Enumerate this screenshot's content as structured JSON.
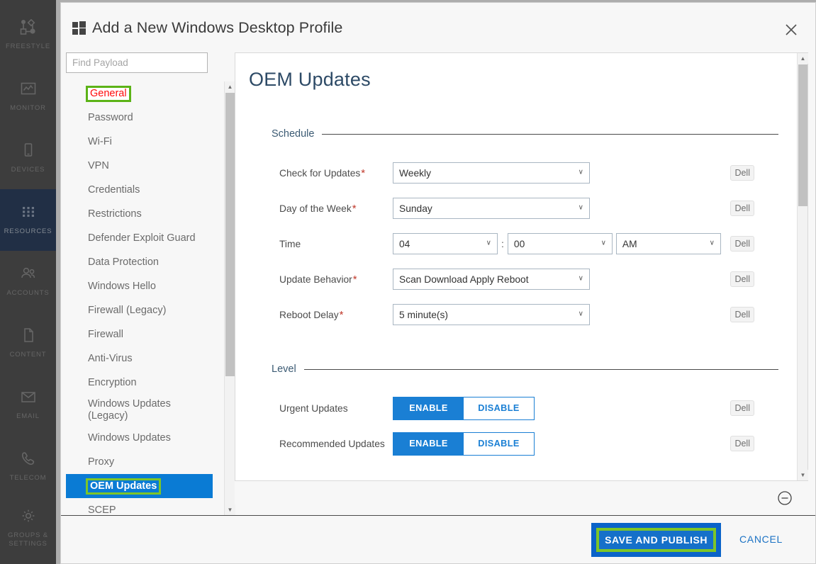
{
  "rail": {
    "items": [
      {
        "label": "FREESTYLE",
        "icon": "freestyle-icon",
        "active": false
      },
      {
        "label": "MONITOR",
        "icon": "monitor-icon",
        "active": false
      },
      {
        "label": "DEVICES",
        "icon": "devices-icon",
        "active": false
      },
      {
        "label": "RESOURCES",
        "icon": "resources-icon",
        "active": true
      },
      {
        "label": "ACCOUNTS",
        "icon": "accounts-icon",
        "active": false
      },
      {
        "label": "CONTENT",
        "icon": "content-icon",
        "active": false
      },
      {
        "label": "EMAIL",
        "icon": "email-icon",
        "active": false
      },
      {
        "label": "TELECOM",
        "icon": "telecom-icon",
        "active": false
      },
      {
        "label": "GROUPS & SETTINGS",
        "icon": "gear-icon",
        "active": false
      }
    ]
  },
  "modal": {
    "title": "Add a New Windows Desktop Profile",
    "close_label": "✕"
  },
  "search": {
    "placeholder": "Find Payload",
    "value": ""
  },
  "payloads": {
    "items": [
      {
        "label": "General",
        "selected": false,
        "highlight": true
      },
      {
        "label": "Password",
        "selected": false,
        "highlight": false
      },
      {
        "label": "Wi-Fi",
        "selected": false,
        "highlight": false
      },
      {
        "label": "VPN",
        "selected": false,
        "highlight": false
      },
      {
        "label": "Credentials",
        "selected": false,
        "highlight": false
      },
      {
        "label": "Restrictions",
        "selected": false,
        "highlight": false
      },
      {
        "label": "Defender Exploit Guard",
        "selected": false,
        "highlight": false
      },
      {
        "label": "Data Protection",
        "selected": false,
        "highlight": false
      },
      {
        "label": "Windows Hello",
        "selected": false,
        "highlight": false
      },
      {
        "label": "Firewall (Legacy)",
        "selected": false,
        "highlight": false
      },
      {
        "label": "Firewall",
        "selected": false,
        "highlight": false
      },
      {
        "label": "Anti-Virus",
        "selected": false,
        "highlight": false
      },
      {
        "label": "Encryption",
        "selected": false,
        "highlight": false
      },
      {
        "label": "Windows Updates (Legacy)",
        "selected": false,
        "highlight": false
      },
      {
        "label": "Windows Updates",
        "selected": false,
        "highlight": false
      },
      {
        "label": "Proxy",
        "selected": false,
        "highlight": false
      },
      {
        "label": "OEM Updates",
        "selected": true,
        "highlight": true
      },
      {
        "label": "SCEP",
        "selected": false,
        "highlight": false
      }
    ]
  },
  "content": {
    "page_title": "OEM Updates",
    "badge_label": "Dell",
    "sections": [
      {
        "name": "Schedule",
        "rows": [
          {
            "label": "Check for Updates",
            "required": true,
            "type": "select",
            "value": "Weekly"
          },
          {
            "label": "Day of the Week",
            "required": true,
            "type": "select",
            "value": "Sunday"
          },
          {
            "label": "Time",
            "required": false,
            "type": "time",
            "hour": "04",
            "minute": "00",
            "meridiem": "AM",
            "separator": ":"
          },
          {
            "label": "Update Behavior",
            "required": true,
            "type": "select",
            "value": "Scan Download Apply Reboot"
          },
          {
            "label": "Reboot Delay",
            "required": true,
            "type": "select",
            "value": "5 minute(s)"
          }
        ]
      },
      {
        "name": "Level",
        "rows": [
          {
            "label": "Urgent Updates",
            "required": false,
            "type": "toggle",
            "on_label": "ENABLE",
            "off_label": "DISABLE",
            "state": "on"
          },
          {
            "label": "Recommended Updates",
            "required": false,
            "type": "toggle",
            "on_label": "ENABLE",
            "off_label": "DISABLE",
            "state": "on"
          }
        ]
      }
    ]
  },
  "footer": {
    "save_label": "SAVE AND PUBLISH",
    "cancel_label": "CANCEL"
  },
  "colors": {
    "accent_blue": "#0a7bd4",
    "toggle_blue": "#1a7fd4",
    "highlight_green": "#7dc528",
    "highlight_red": "#ff0a0a",
    "rail_active": "#1d3557",
    "required_red": "#c0392b"
  }
}
